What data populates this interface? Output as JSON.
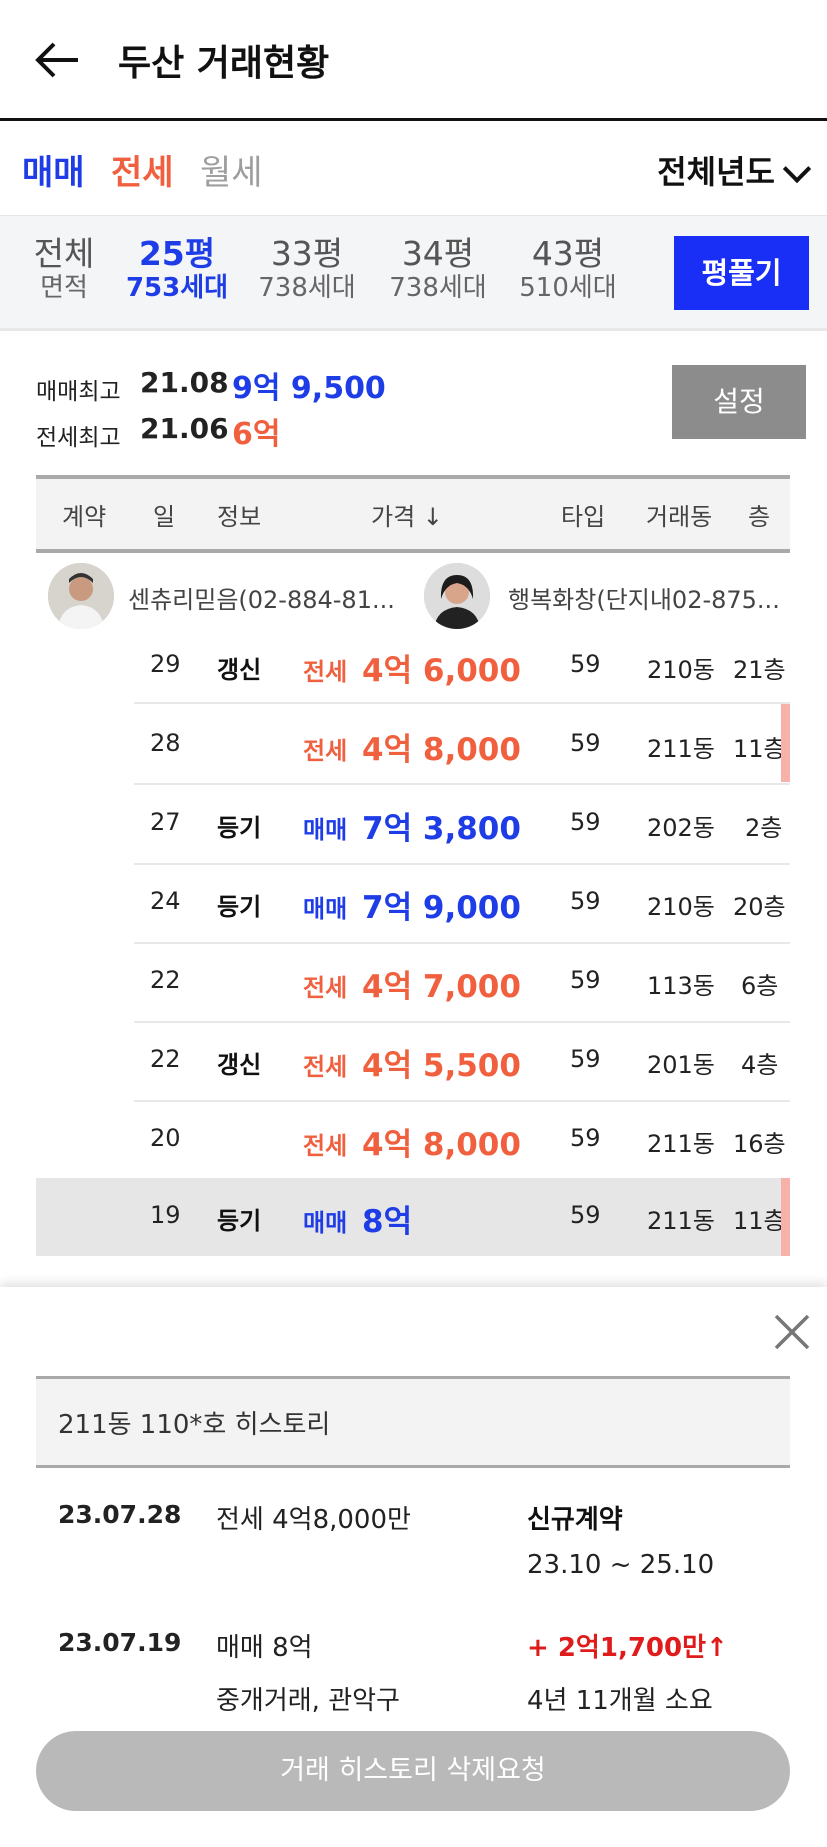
{
  "header": {
    "title": "두산 거래현황"
  },
  "deal_types": [
    {
      "label": "매매",
      "color": "#1e3de6"
    },
    {
      "label": "전세",
      "color": "#f0603f"
    },
    {
      "label": "월세",
      "color": "#9e9e9e"
    }
  ],
  "year_filter": "전체년도",
  "sizes": [
    {
      "label": "전체",
      "sub": "면적"
    },
    {
      "label": "25평",
      "sub": "753세대"
    },
    {
      "label": "33평",
      "sub": "738세대"
    },
    {
      "label": "34평",
      "sub": "738세대"
    },
    {
      "label": "43평",
      "sub": "510세대"
    }
  ],
  "pyeong_button": "평풀기",
  "summary": {
    "sale_label": "매매최고",
    "sale_date": "21.08",
    "sale_price": "9억 9,500",
    "jeonse_label": "전세최고",
    "jeonse_date": "21.06",
    "jeonse_price": "6억",
    "settings_button": "설정"
  },
  "table_headers": [
    "계약",
    "일",
    "정보",
    "가격 ↓",
    "타입",
    "거래동",
    "층"
  ],
  "agents": [
    {
      "name": "센츄리믿음(02-884-81..."
    },
    {
      "name": "행복화창(단지내02-875..."
    }
  ],
  "rows": [
    {
      "day": "29",
      "info": "갱신",
      "kind": "전세",
      "price": "4억 6,000",
      "type": "59",
      "dong": "210동",
      "floor": "21층"
    },
    {
      "day": "28",
      "info": "",
      "kind": "전세",
      "price": "4억 8,000",
      "type": "59",
      "dong": "211동",
      "floor": "11층"
    },
    {
      "day": "27",
      "info": "등기",
      "kind": "매매",
      "price": "7억 3,800",
      "type": "59",
      "dong": "202동",
      "floor": "2층"
    },
    {
      "day": "24",
      "info": "등기",
      "kind": "매매",
      "price": "7억 9,000",
      "type": "59",
      "dong": "210동",
      "floor": "20층"
    },
    {
      "day": "22",
      "info": "",
      "kind": "전세",
      "price": "4억 7,000",
      "type": "59",
      "dong": "113동",
      "floor": "6층"
    },
    {
      "day": "22",
      "info": "갱신",
      "kind": "전세",
      "price": "4억 5,500",
      "type": "59",
      "dong": "201동",
      "floor": "4층"
    },
    {
      "day": "20",
      "info": "",
      "kind": "전세",
      "price": "4억 8,000",
      "type": "59",
      "dong": "211동",
      "floor": "16층"
    },
    {
      "day": "19",
      "info": "등기",
      "kind": "매매",
      "price": "8억",
      "type": "59",
      "dong": "211동",
      "floor": "11층"
    }
  ],
  "history": {
    "title": "211동 110*호 히스토리",
    "entries": [
      {
        "date": "23.07.28",
        "line1": "전세 4억8,000만",
        "line2": "",
        "right1": "신규계약",
        "right2": "23.10 ~ 25.10"
      },
      {
        "date": "23.07.19",
        "line1": "매매 8억",
        "line2": "중개거래, 관악구",
        "right1": "+ 2억1,700만↑",
        "right2": "4년 11개월 소요"
      }
    ],
    "delete_button": "거래 히스토리 삭제요청"
  }
}
